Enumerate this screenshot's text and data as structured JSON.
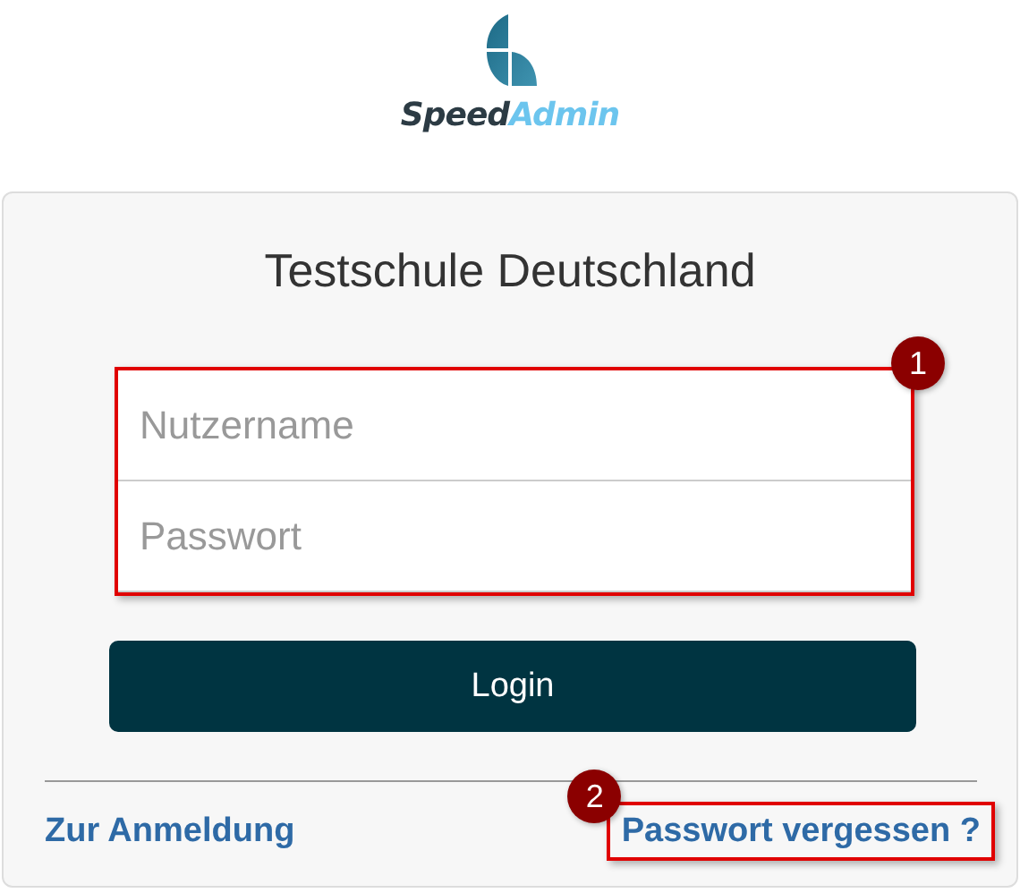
{
  "logo": {
    "primary": "Speed",
    "secondary": "Admin"
  },
  "login_card": {
    "title": "Testschule Deutschland",
    "fields": [
      {
        "placeholder": "Nutzername"
      },
      {
        "placeholder": "Passwort"
      }
    ],
    "login_button": "Login",
    "links": [
      {
        "label": "Zur Anmeldung",
        "highlighted": false
      },
      {
        "label": "Passwort vergessen ?",
        "highlighted": true,
        "annotation": "2"
      }
    ]
  },
  "fields_annotation": "1"
}
